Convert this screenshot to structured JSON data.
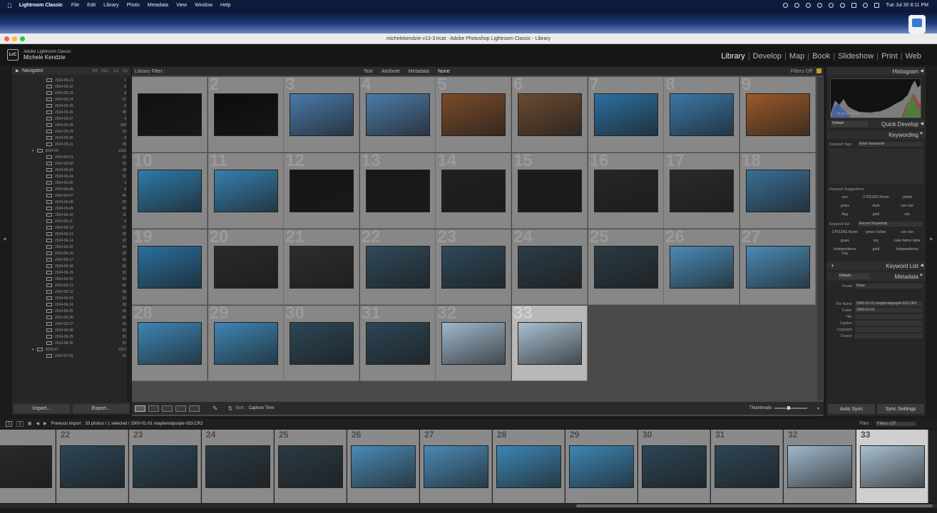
{
  "menubar": {
    "app_name": "Lightroom Classic",
    "items": [
      "File",
      "Edit",
      "Library",
      "Photo",
      "Metadata",
      "View",
      "Window",
      "Help"
    ],
    "clock": "Tue Jul 30  8:11 PM"
  },
  "window": {
    "title": "michelekendzie-v13-3.lrcat - Adobe Photoshop Lightroom Classic - Library"
  },
  "identity": {
    "logo": "LrC",
    "line1": "Adobe Lightroom Classic",
    "user": "Michele Kendzie"
  },
  "modules": [
    "Library",
    "Develop",
    "Map",
    "Book",
    "Slideshow",
    "Print",
    "Web"
  ],
  "left_panel": {
    "navigator": "Navigator",
    "nav_opts": [
      "FIT",
      "FILL",
      "1:1",
      "3:1"
    ],
    "folders": [
      {
        "name": "2024-05-21",
        "count": "7"
      },
      {
        "name": "2024-05-22",
        "count": "8"
      },
      {
        "name": "2024-05-23",
        "count": "8"
      },
      {
        "name": "2024-05-24",
        "count": "21"
      },
      {
        "name": "2024-05-25",
        "count": "9"
      },
      {
        "name": "2024-05-26",
        "count": "45"
      },
      {
        "name": "2024-05-27",
        "count": "9"
      },
      {
        "name": "2024-05-28",
        "count": "104"
      },
      {
        "name": "2024-05-29",
        "count": "24"
      },
      {
        "name": "2024-05-30",
        "count": "9"
      },
      {
        "name": "2024-05-31",
        "count": "36"
      },
      {
        "name": "2024-06",
        "count": "1215",
        "parent": true
      },
      {
        "name": "2024-06-01",
        "count": "33"
      },
      {
        "name": "2024-06-02",
        "count": "33"
      },
      {
        "name": "2024-06-03",
        "count": "18"
      },
      {
        "name": "2024-06-04",
        "count": "22"
      },
      {
        "name": "2024-06-05",
        "count": "3"
      },
      {
        "name": "2024-06-06",
        "count": "8"
      },
      {
        "name": "2024-06-07",
        "count": "45"
      },
      {
        "name": "2024-06-08",
        "count": "22"
      },
      {
        "name": "2024-06-09",
        "count": "45"
      },
      {
        "name": "2024-06-10",
        "count": "11"
      },
      {
        "name": "2024-06-11",
        "count": "9"
      },
      {
        "name": "2024-06-12",
        "count": "27"
      },
      {
        "name": "2024-06-13",
        "count": "28"
      },
      {
        "name": "2024-06-14",
        "count": "22"
      },
      {
        "name": "2024-06-15",
        "count": "44"
      },
      {
        "name": "2024-06-16",
        "count": "28"
      },
      {
        "name": "2024-06-17",
        "count": "33"
      },
      {
        "name": "2024-06-18",
        "count": "36"
      },
      {
        "name": "2024-06-19",
        "count": "33"
      },
      {
        "name": "2024-06-20",
        "count": "33"
      },
      {
        "name": "2024-06-21",
        "count": "35"
      },
      {
        "name": "2024-06-22",
        "count": "28"
      },
      {
        "name": "2024-06-23",
        "count": "33"
      },
      {
        "name": "2024-06-24",
        "count": "18"
      },
      {
        "name": "2024-06-25",
        "count": "25"
      },
      {
        "name": "2024-06-26",
        "count": "45"
      },
      {
        "name": "2024-06-27",
        "count": "33"
      },
      {
        "name": "2024-06-28",
        "count": "33"
      },
      {
        "name": "2024-06-29",
        "count": "33"
      },
      {
        "name": "2024-06-30",
        "count": "33"
      },
      {
        "name": "2024-07",
        "count": "2212",
        "parent": true
      },
      {
        "name": "2024-07-01",
        "count": "22"
      }
    ],
    "import_label": "Import...",
    "export_label": "Export..."
  },
  "filter_bar": {
    "title": "Library Filter :",
    "options": [
      "Text",
      "Attribute",
      "Metadata",
      "None"
    ],
    "filters_off": "Filters Off"
  },
  "grid": {
    "cells": [
      {
        "n": "",
        "c": "#111111"
      },
      {
        "n": "2",
        "c": "#0c0c0c"
      },
      {
        "n": "3",
        "c": "#4a7aa8"
      },
      {
        "n": "4",
        "c": "#4d7ba6"
      },
      {
        "n": "5",
        "c": "#7a4b2a"
      },
      {
        "n": "6",
        "c": "#6a4a30"
      },
      {
        "n": "7",
        "c": "#2c6fa0"
      },
      {
        "n": "8",
        "c": "#3b78a8"
      },
      {
        "n": "9",
        "c": "#9a5a2a"
      },
      {
        "n": "10",
        "c": "#2f7aa8"
      },
      {
        "n": "11",
        "c": "#3680ae"
      },
      {
        "n": "12",
        "c": "#151515"
      },
      {
        "n": "13",
        "c": "#181818"
      },
      {
        "n": "14",
        "c": "#202020"
      },
      {
        "n": "15",
        "c": "#1c1c1c"
      },
      {
        "n": "16",
        "c": "#262626"
      },
      {
        "n": "17",
        "c": "#2a2a2a"
      },
      {
        "n": "18",
        "c": "#3a6f95"
      },
      {
        "n": "19",
        "c": "#2a6f9e"
      },
      {
        "n": "20",
        "c": "#2a2a2a"
      },
      {
        "n": "21",
        "c": "#2d2d2d"
      },
      {
        "n": "22",
        "c": "#2f4a5a"
      },
      {
        "n": "23",
        "c": "#2e4959"
      },
      {
        "n": "24",
        "c": "#2c3c47"
      },
      {
        "n": "25",
        "c": "#2b3a44"
      },
      {
        "n": "26",
        "c": "#4a8ab5"
      },
      {
        "n": "27",
        "c": "#4a8ab5"
      },
      {
        "n": "28",
        "c": "#3d86b4"
      },
      {
        "n": "29",
        "c": "#3d86b4"
      },
      {
        "n": "30",
        "c": "#2d4656"
      },
      {
        "n": "31",
        "c": "#2d4656"
      },
      {
        "n": "32",
        "c": "#9fb8cc"
      },
      {
        "n": "33",
        "c": "#a8bfd0"
      }
    ],
    "selected": 33
  },
  "toolbar": {
    "sort_label": "Sort :",
    "sort_value": "Capture Time",
    "thumbnails_label": "Thumbnails"
  },
  "right_panel": {
    "histogram": "Histogram",
    "original_photo": "Original Photo",
    "quick_develop": "Quick Develop",
    "quick_preset": "Default",
    "keywording": "Keywording",
    "keyword_tags_label": "Keyword Tags",
    "keyword_tags_value": "Enter Keywords",
    "keyword_suggestions": "Keyword Suggestions",
    "suggestions": [
      "sun",
      "2 PIZZAS Rome",
      "yellow",
      "grass",
      "dusk",
      "sun rise",
      "flag",
      "gold",
      "sky"
    ],
    "keyword_set_label": "Keyword Set",
    "keyword_set_value": "Recent Keywords",
    "recent": [
      "2 PIZZAS Rome",
      "green Father",
      "sun rise",
      "grass",
      "sky",
      "cake father table",
      "Independence Day",
      "gold",
      "Independence"
    ],
    "keyword_list": "Keyword List",
    "metadata": "Metadata",
    "metadata_preset": "Default",
    "preset_label": "Preset",
    "preset_value": "None",
    "rows": [
      {
        "k": "File Name",
        "v": "2000-01-01 maybenotpurple-033.CR2"
      },
      {
        "k": "Folder",
        "v": "2000-01-01"
      },
      {
        "k": "Title",
        "v": ""
      },
      {
        "k": "Caption",
        "v": ""
      },
      {
        "k": "Copyright",
        "v": ""
      },
      {
        "k": "Creator",
        "v": ""
      }
    ],
    "sync_label": "Auto Sync",
    "sync_settings": "Sync Settings"
  },
  "filmstrip": {
    "page1": "1",
    "page2": "2",
    "source": "Previous Import",
    "info": "33 photos / 1 selected / 2000-01-01 maybenotpurple-033.CR2",
    "filter_label": "Filter :",
    "filter_value": "Filters Off",
    "cells": [
      {
        "n": "",
        "c": "#2a2a2a"
      },
      {
        "n": "22",
        "c": "#2c4656"
      },
      {
        "n": "23",
        "c": "#2c4656"
      },
      {
        "n": "24",
        "c": "#2b3a44"
      },
      {
        "n": "25",
        "c": "#2b3a44"
      },
      {
        "n": "26",
        "c": "#4a8ab5"
      },
      {
        "n": "27",
        "c": "#4a8ab5"
      },
      {
        "n": "28",
        "c": "#3d86b4"
      },
      {
        "n": "29",
        "c": "#3d86b4"
      },
      {
        "n": "30",
        "c": "#2d4656"
      },
      {
        "n": "31",
        "c": "#2d4656"
      },
      {
        "n": "32",
        "c": "#9fb8cc"
      },
      {
        "n": "33",
        "c": "#a8bfd0"
      }
    ]
  }
}
